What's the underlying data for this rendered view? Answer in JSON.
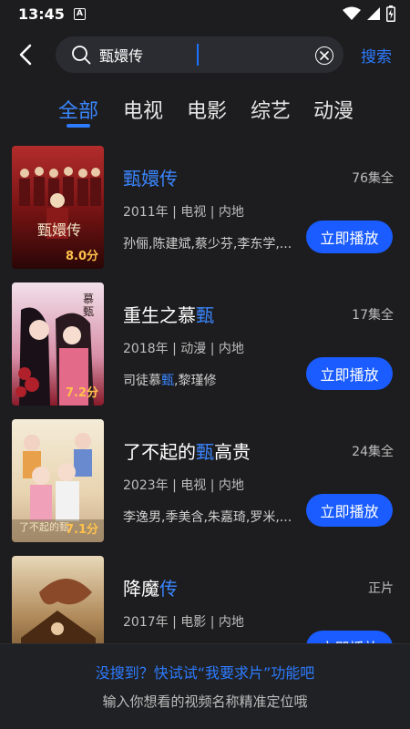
{
  "status_bar": {
    "time": "13:45",
    "a_badge": "A"
  },
  "search": {
    "query": "甄嬛传",
    "search_label": "搜索"
  },
  "tabs": [
    {
      "label": "全部",
      "active": true
    },
    {
      "label": "电视",
      "active": false
    },
    {
      "label": "电影",
      "active": false
    },
    {
      "label": "综艺",
      "active": false
    },
    {
      "label": "动漫",
      "active": false
    }
  ],
  "results": [
    {
      "title_pre": "",
      "title_hl": "甄嬛传",
      "title_post": "",
      "episodes": "76集全",
      "meta": "2011年 | 电视 | 内地",
      "cast_pre": "孙俪,陈建斌,蔡少芬,李东学,...",
      "cast_hl": "",
      "cast_post": "",
      "score": "8.0分",
      "play_label": "立即播放"
    },
    {
      "title_pre": "重生之慕",
      "title_hl": "甄",
      "title_post": "",
      "episodes": "17集全",
      "meta": "2018年 | 动漫 | 内地",
      "cast_pre": "司徒慕",
      "cast_hl": "甄",
      "cast_post": ",黎瑾修",
      "score": "7.2分",
      "play_label": "立即播放"
    },
    {
      "title_pre": "了不起的",
      "title_hl": "甄",
      "title_post": "高贵",
      "episodes": "24集全",
      "meta": "2023年 | 电视 | 内地",
      "cast_pre": "李逸男,季美含,朱嘉琦,罗米,...",
      "cast_hl": "",
      "cast_post": "",
      "score": "7.1分",
      "play_label": "立即播放"
    },
    {
      "title_pre": "降魔",
      "title_hl": "传",
      "title_post": "",
      "episodes": "正片",
      "meta": "2017年 | 电影 | 内地",
      "cast_pre": "",
      "cast_hl": "",
      "cast_post": "",
      "score": "",
      "play_label": "立即播放"
    }
  ],
  "footer": {
    "request_link": "没搜到？快试试“我要求片”功能吧",
    "tip": "输入你想看的视频名称精准定位哦"
  },
  "colors": {
    "accent": "#2d7bff",
    "button": "#1a5cff",
    "background": "#1d1d1f",
    "score": "#ffc14d"
  }
}
